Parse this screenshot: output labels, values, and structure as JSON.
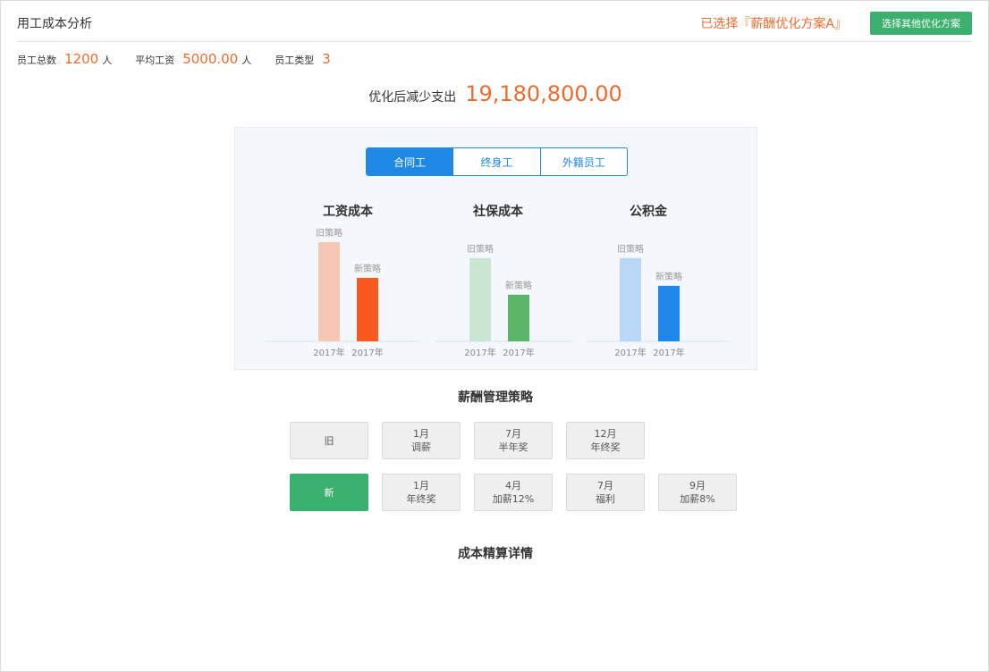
{
  "header": {
    "title": "用工成本分析",
    "selected_plan": "已选择『薪酬优化方案A』",
    "select_other_label": "选择其他优化方案"
  },
  "stats": [
    {
      "label": "员工总数",
      "value": "1200",
      "unit": "人"
    },
    {
      "label": "平均工资",
      "value": "5000.00",
      "unit": "人"
    },
    {
      "label": "员工类型",
      "value": "3",
      "unit": ""
    }
  ],
  "reduction": {
    "label": "优化后减少支出",
    "value": "19,180,800.00"
  },
  "tabs": [
    "合同工",
    "终身工",
    "外籍员工"
  ],
  "active_tab": "合同工",
  "colors": {
    "accent_orange": "#ee6b30",
    "green": "#3cb06f",
    "blue": "#1e88e5"
  },
  "chart_data": [
    {
      "type": "bar",
      "title": "工资成本",
      "categories": [
        "2017年",
        "2017年"
      ],
      "bar_labels": [
        "旧策略",
        "新策略"
      ],
      "values": [
        100,
        64
      ],
      "colors": [
        "#f6c7b5",
        "#f9591f"
      ]
    },
    {
      "type": "bar",
      "title": "社保成本",
      "categories": [
        "2017年",
        "2017年"
      ],
      "bar_labels": [
        "旧策略",
        "新策略"
      ],
      "values": [
        84,
        47
      ],
      "colors": [
        "#c9e6d3",
        "#5ab569"
      ]
    },
    {
      "type": "bar",
      "title": "公积金",
      "categories": [
        "2017年",
        "2017年"
      ],
      "bar_labels": [
        "旧策略",
        "新策略"
      ],
      "values": [
        84,
        56
      ],
      "colors": [
        "#b8d8f6",
        "#1d88ea"
      ]
    }
  ],
  "strategy": {
    "title": "薪酬管理策略",
    "old_label": "旧",
    "new_label": "新",
    "old_items": [
      {
        "month": "1月",
        "action": "调薪"
      },
      {
        "month": "7月",
        "action": "半年奖"
      },
      {
        "month": "12月",
        "action": "年终奖"
      }
    ],
    "new_items": [
      {
        "month": "1月",
        "action": "年终奖"
      },
      {
        "month": "4月",
        "action": "加薪12%"
      },
      {
        "month": "7月",
        "action": "福利"
      },
      {
        "month": "9月",
        "action": "加薪8%"
      }
    ]
  },
  "details_title": "成本精算详情"
}
